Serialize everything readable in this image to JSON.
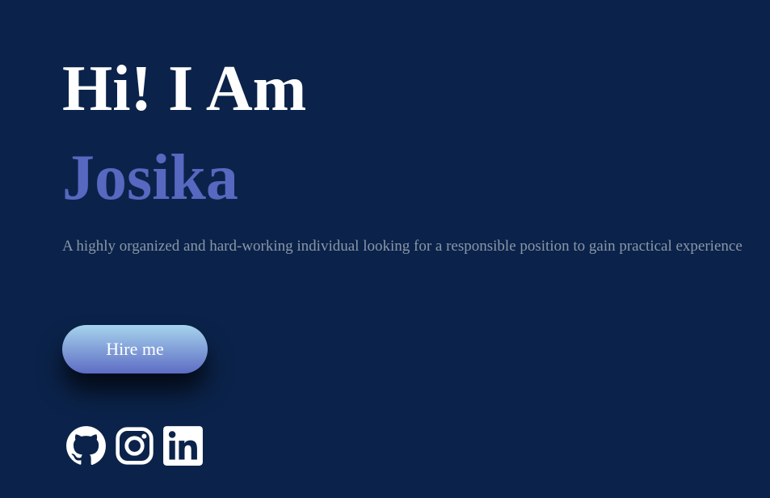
{
  "hero": {
    "greeting": "Hi! I Am",
    "name": "Josika",
    "tagline": "A highly organized and hard-working individual looking for a responsible position to gain practical experience",
    "cta_label": "Hire me"
  },
  "socials": [
    {
      "icon": "github-icon"
    },
    {
      "icon": "instagram-icon"
    },
    {
      "icon": "linkedin-icon"
    }
  ],
  "colors": {
    "background": "#0b234a",
    "heading": "#ffffff",
    "name_accent": "#5668c0",
    "tagline": "#8a96a8",
    "button_gradient_top": "#a6d4ec",
    "button_gradient_bottom": "#5e6cc4"
  }
}
